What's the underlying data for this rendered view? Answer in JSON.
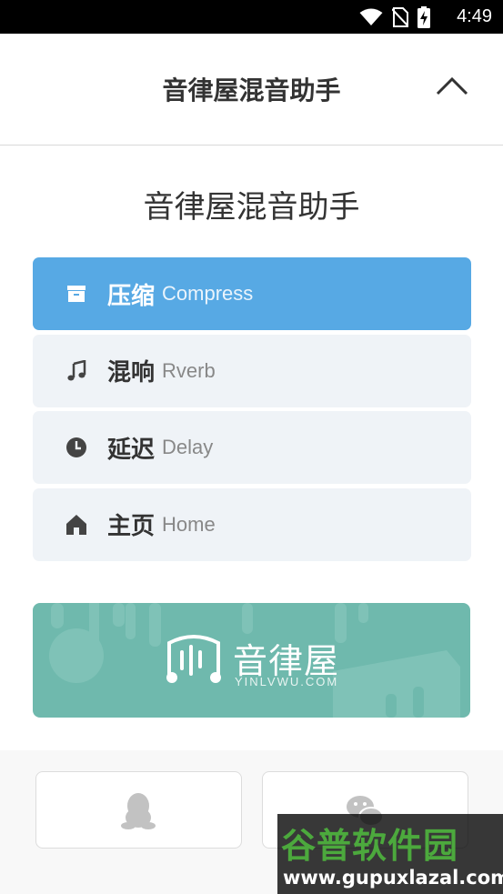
{
  "status_bar": {
    "time": "4:49",
    "icons": [
      "wifi-icon",
      "no-sim-icon",
      "battery-charging-icon"
    ]
  },
  "app_bar": {
    "title": "音律屋混音助手",
    "collapse_icon": "chevron-up-icon"
  },
  "page": {
    "heading": "音律屋混音助手"
  },
  "menu": {
    "items": [
      {
        "zh": "压缩",
        "en": "Compress",
        "icon": "archive-icon",
        "active": true
      },
      {
        "zh": "混响",
        "en": "Rverb",
        "icon": "music-note-icon",
        "active": false
      },
      {
        "zh": "延迟",
        "en": "Delay",
        "icon": "clock-icon",
        "active": false
      },
      {
        "zh": "主页",
        "en": "Home",
        "icon": "home-icon",
        "active": false
      }
    ]
  },
  "banner": {
    "brand_name": "音律屋",
    "brand_url": "YINLVWU.COM"
  },
  "share": {
    "items": [
      {
        "icon": "qq-icon"
      },
      {
        "icon": "wechat-icon"
      }
    ]
  },
  "watermark": {
    "title": "谷普软件园",
    "url": "www.gupuxlazal.com"
  },
  "colors": {
    "accent": "#57a9e4",
    "menu_bg": "#eff3f7",
    "banner": "#6fb9ad",
    "watermark_green": "#4ca93d"
  }
}
